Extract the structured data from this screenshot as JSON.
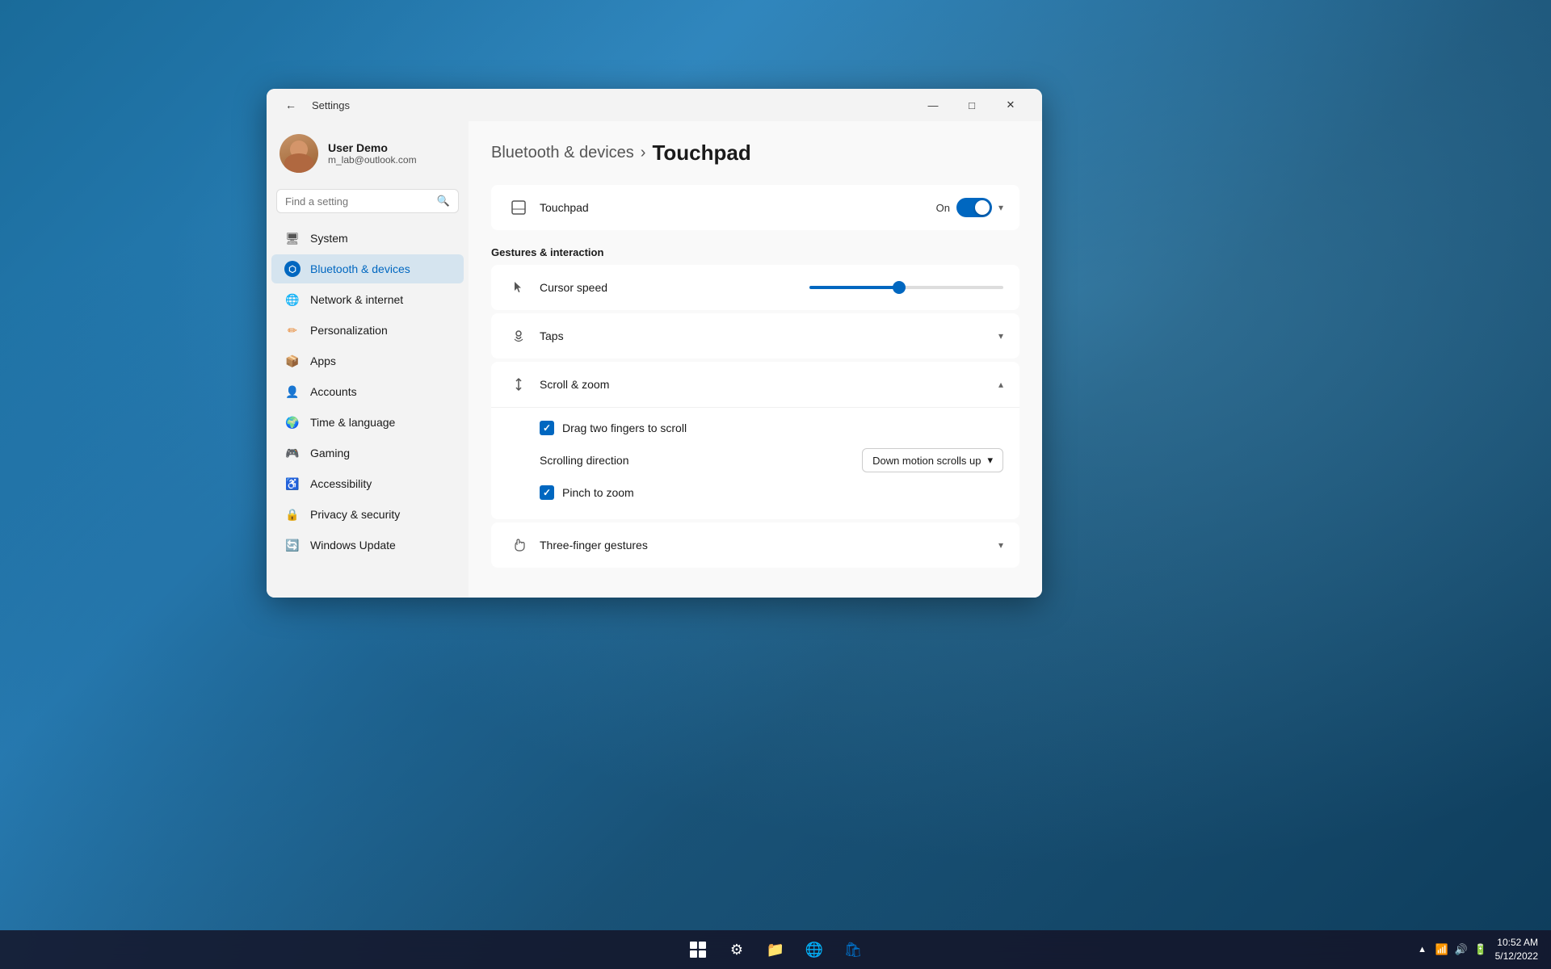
{
  "window": {
    "title": "Settings",
    "back_label": "←"
  },
  "titlebar": {
    "minimize": "—",
    "maximize": "□",
    "close": "✕"
  },
  "user": {
    "name": "User Demo",
    "email": "m_lab@outlook.com"
  },
  "search": {
    "placeholder": "Find a setting",
    "icon": "🔍"
  },
  "nav": [
    {
      "id": "system",
      "label": "System",
      "icon": "🖥"
    },
    {
      "id": "bluetooth",
      "label": "Bluetooth & devices",
      "icon": "B",
      "active": true
    },
    {
      "id": "network",
      "label": "Network & internet",
      "icon": "🌐"
    },
    {
      "id": "personalization",
      "label": "Personalization",
      "icon": "✏"
    },
    {
      "id": "apps",
      "label": "Apps",
      "icon": "📦"
    },
    {
      "id": "accounts",
      "label": "Accounts",
      "icon": "👤"
    },
    {
      "id": "time",
      "label": "Time & language",
      "icon": "🌍"
    },
    {
      "id": "gaming",
      "label": "Gaming",
      "icon": "🎮"
    },
    {
      "id": "accessibility",
      "label": "Accessibility",
      "icon": "♿"
    },
    {
      "id": "privacy",
      "label": "Privacy & security",
      "icon": "🔒"
    },
    {
      "id": "update",
      "label": "Windows Update",
      "icon": "🔄"
    }
  ],
  "breadcrumb": {
    "parent": "Bluetooth & devices",
    "separator": "›",
    "current": "Touchpad"
  },
  "touchpad_toggle": {
    "label": "Touchpad",
    "status": "On",
    "enabled": true
  },
  "gestures_section": {
    "title": "Gestures & interaction"
  },
  "cursor_speed": {
    "label": "Cursor speed",
    "value": 45
  },
  "taps": {
    "label": "Taps",
    "expanded": false
  },
  "scroll_zoom": {
    "label": "Scroll & zoom",
    "expanded": true,
    "drag_two_fingers": {
      "label": "Drag two fingers to scroll",
      "checked": true
    },
    "scrolling_direction": {
      "label": "Scrolling direction",
      "value": "Down motion scrolls up"
    },
    "pinch_to_zoom": {
      "label": "Pinch to zoom",
      "checked": true
    }
  },
  "three_finger": {
    "label": "Three-finger gestures",
    "expanded": false
  },
  "taskbar": {
    "time": "10:52 AM",
    "date": "5/12/2022"
  }
}
